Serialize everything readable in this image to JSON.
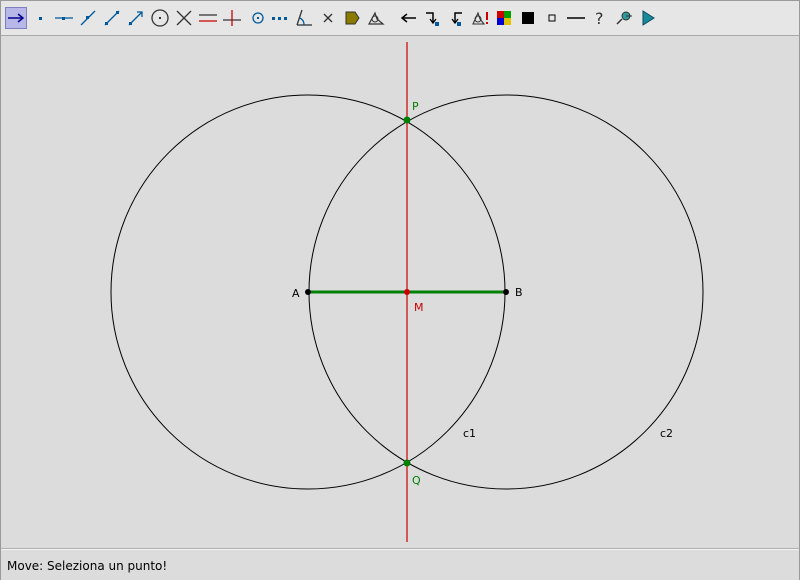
{
  "toolbar": {
    "tools": [
      {
        "icon": "move-arrow-icon",
        "active": true
      },
      {
        "icon": "point-icon"
      },
      {
        "icon": "line-through-two-points-icon"
      },
      {
        "icon": "segment-icon"
      },
      {
        "icon": "ray-icon"
      },
      {
        "icon": "vector-icon"
      },
      {
        "icon": "circle-icon"
      },
      {
        "icon": "intersect-icon"
      },
      {
        "icon": "parallel-line-icon"
      },
      {
        "icon": "perpendicular-line-icon"
      },
      {
        "icon": "midpoint-icon"
      },
      {
        "icon": "locus-icon"
      },
      {
        "icon": "angle-icon"
      },
      {
        "icon": "delete-icon"
      },
      {
        "icon": "fill-polygon-icon"
      },
      {
        "icon": "measure-icon"
      },
      {
        "icon": "undo-icon"
      },
      {
        "icon": "redo-forward-icon"
      },
      {
        "icon": "redo-back-icon"
      },
      {
        "icon": "macro-icon"
      },
      {
        "icon": "color-palette-icon"
      },
      {
        "icon": "filled-square-icon"
      },
      {
        "icon": "small-square-icon"
      },
      {
        "icon": "line-style-icon"
      },
      {
        "icon": "help-icon"
      },
      {
        "icon": "zoom-icon"
      },
      {
        "icon": "play-icon"
      }
    ]
  },
  "colors": {
    "segment": "#008000",
    "perpendicular": "#cc0000",
    "point_green": "#008000",
    "point_red": "#cc0000",
    "point_black": "#000000"
  },
  "labels": {
    "A": "A",
    "B": "B",
    "M": "M",
    "P": "P",
    "Q": "Q",
    "c1": "c1",
    "c2": "c2"
  },
  "status": {
    "text": "Move: Seleziona un punto!"
  }
}
